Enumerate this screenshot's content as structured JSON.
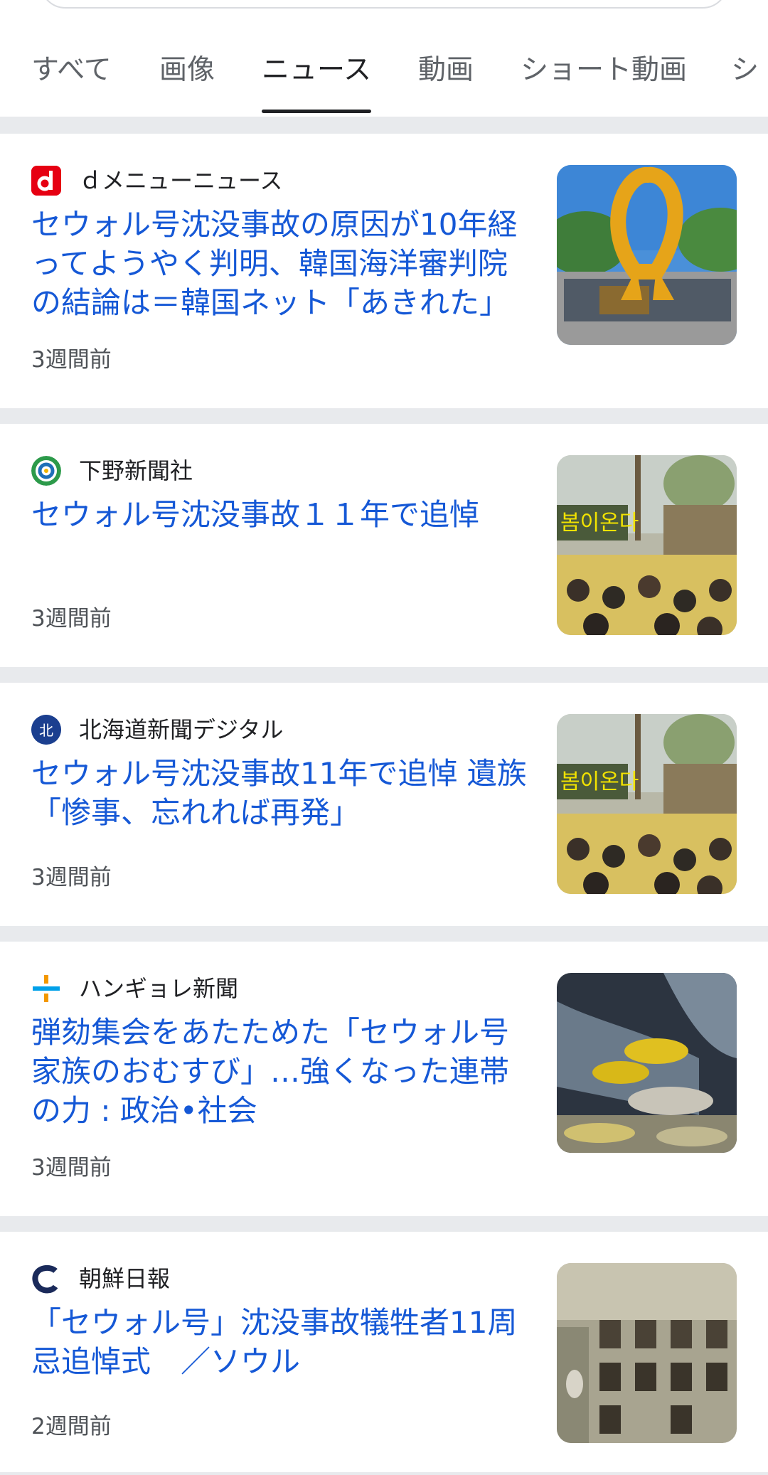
{
  "tabs": [
    {
      "label": "すべて",
      "active": false
    },
    {
      "label": "画像",
      "active": false
    },
    {
      "label": "ニュース",
      "active": true
    },
    {
      "label": "動画",
      "active": false
    },
    {
      "label": "ショート動画",
      "active": false
    },
    {
      "label": "シ",
      "active": false
    }
  ],
  "articles": [
    {
      "source": "ｄメニューニュース",
      "logo_icon": "d-menu-logo-icon",
      "headline": "セウォル号沈没事故の原因が10年経ってようやく判明、韓国海洋審判院の結論は＝韓国ネット「あきれた」",
      "time": "3週間前",
      "thumbnail": "yellow-ribbon-monument-image"
    },
    {
      "source": "下野新聞社",
      "logo_icon": "shimotsuke-logo-icon",
      "headline": "セウォル号沈没事故１１年で追悼",
      "time": "3週間前",
      "thumbnail": "memorial-ceremony-crowd-image"
    },
    {
      "source": "北海道新聞デジタル",
      "logo_icon": "hokkaido-shimbun-logo-icon",
      "headline": "セウォル号沈没事故11年で追悼 遺族「惨事、忘れれば再発」",
      "time": "3週間前",
      "thumbnail": "memorial-ceremony-crowd-image"
    },
    {
      "source": "ハンギョレ新聞",
      "logo_icon": "hankyoreh-logo-icon",
      "headline": "弾劾集会をあたためた「セウォル号家族のおむすび」…強くなった連帯の力 : 政治•社会",
      "time": "3週間前",
      "thumbnail": "rice-ball-hands-image"
    },
    {
      "source": "朝鮮日報",
      "logo_icon": "chosun-ilbo-logo-icon",
      "headline": "「セウォル号」沈没事故犠牲者11周忌追悼式　／ソウル",
      "time": "2週間前",
      "thumbnail": "memorial-hall-image"
    }
  ],
  "colors": {
    "link": "#1558d6",
    "divider": "#e8eaed",
    "muted": "#4d5156"
  }
}
